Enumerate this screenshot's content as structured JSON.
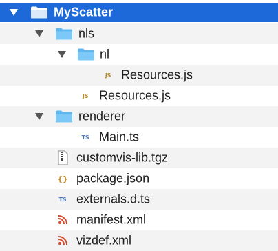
{
  "tree": {
    "root_label": "MyScatter",
    "nls_label": "nls",
    "nl_label": "nl",
    "nl_resources_label": "Resources.js",
    "nls_resources_label": "Resources.js",
    "renderer_label": "renderer",
    "main_label": "Main.ts",
    "customvis_label": "customvis-lib.tgz",
    "package_label": "package.json",
    "externals_label": "externals.d.ts",
    "manifest_label": "manifest.xml",
    "vizdef_label": "vizdef.xml"
  },
  "icons": {
    "js_text": "JS",
    "ts_text": "TS",
    "json_text": "{}"
  },
  "colors": {
    "selection": "#1e69d9",
    "folder": "#5fb7f0",
    "alt_row": "#f3f3f3"
  }
}
